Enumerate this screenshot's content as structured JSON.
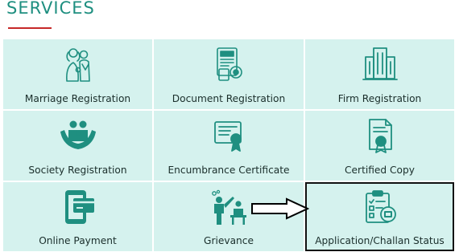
{
  "section": {
    "title": "SERVICES",
    "accent_color": "#c62828",
    "tile_bg": "#d5f2ee",
    "icon_color": "#1f8f80"
  },
  "services": [
    {
      "label": "Marriage Registration",
      "icon": "marriage-icon"
    },
    {
      "label": "Document Registration",
      "icon": "document-icon"
    },
    {
      "label": "Firm Registration",
      "icon": "building-icon"
    },
    {
      "label": "Society Registration",
      "icon": "society-icon"
    },
    {
      "label": "Encumbrance Certificate",
      "icon": "certificate-icon"
    },
    {
      "label": "Certified Copy",
      "icon": "certified-copy-icon"
    },
    {
      "label": "Online Payment",
      "icon": "payment-icon"
    },
    {
      "label": "Grievance",
      "icon": "grievance-icon"
    },
    {
      "label": "Application/Challan Status",
      "icon": "application-status-icon"
    }
  ],
  "annotation": {
    "highlighted_service": "Application/Challan Status",
    "pointer": "arrow-right-icon"
  }
}
